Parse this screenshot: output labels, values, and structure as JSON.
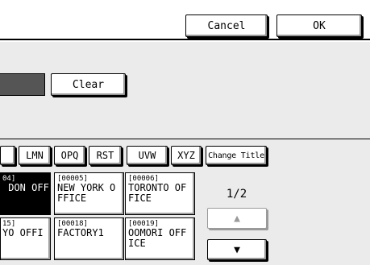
{
  "header": {
    "cancel_label": "Cancel",
    "ok_label": "OK"
  },
  "actions": {
    "clear_label": "Clear"
  },
  "index_tabs": [
    "",
    "LMN",
    "OPQ",
    "RST",
    "UVW",
    "XYZ"
  ],
  "change_title_label": "Change Title",
  "entries": [
    {
      "number": "04]",
      "name": " DON OFF",
      "selected": true
    },
    {
      "number": "[00005]",
      "name": "NEW YORK O\nFFICE",
      "selected": false
    },
    {
      "number": "[00006]",
      "name": "TORONTO OF\nFICE",
      "selected": false
    },
    {
      "number": "15]",
      "name": "YO OFFI",
      "selected": false
    },
    {
      "number": "[00018]",
      "name": "FACTORY1",
      "selected": false
    },
    {
      "number": "[00019]",
      "name": "OOMORI OFF\nICE",
      "selected": false
    }
  ],
  "pagination": {
    "indicator": "1/2",
    "up_icon": "▲",
    "down_icon": "▼"
  }
}
